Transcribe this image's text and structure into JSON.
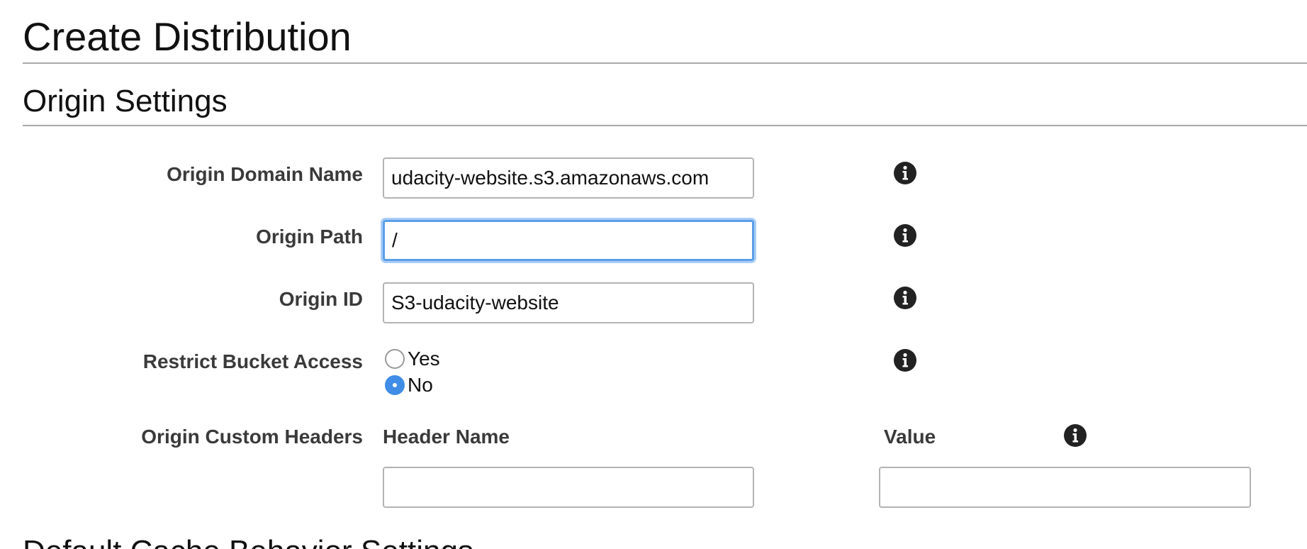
{
  "page": {
    "title": "Create Distribution",
    "section_title": "Origin Settings",
    "next_section_title": "Default Cache Behavior Settings"
  },
  "form": {
    "origin_domain_name": {
      "label": "Origin Domain Name",
      "value": "udacity-website.s3.amazonaws.com",
      "icon": "info-icon"
    },
    "origin_path": {
      "label": "Origin Path",
      "value": "/",
      "focused": true,
      "icon": "info-icon"
    },
    "origin_id": {
      "label": "Origin ID",
      "value": "S3-udacity-website",
      "icon": "info-icon"
    },
    "restrict_bucket_access": {
      "label": "Restrict Bucket Access",
      "options": [
        "Yes",
        "No"
      ],
      "selected": "No",
      "icon": "info-icon"
    },
    "origin_custom_headers": {
      "label": "Origin Custom Headers",
      "header_name_label": "Header Name",
      "value_label": "Value",
      "header_name_value": "",
      "value_value": "",
      "icon": "info-icon"
    }
  },
  "colors": {
    "focus_border": "#5b9ee8",
    "radio_selected": "#3f8de6",
    "rule": "#a9a9a9"
  }
}
